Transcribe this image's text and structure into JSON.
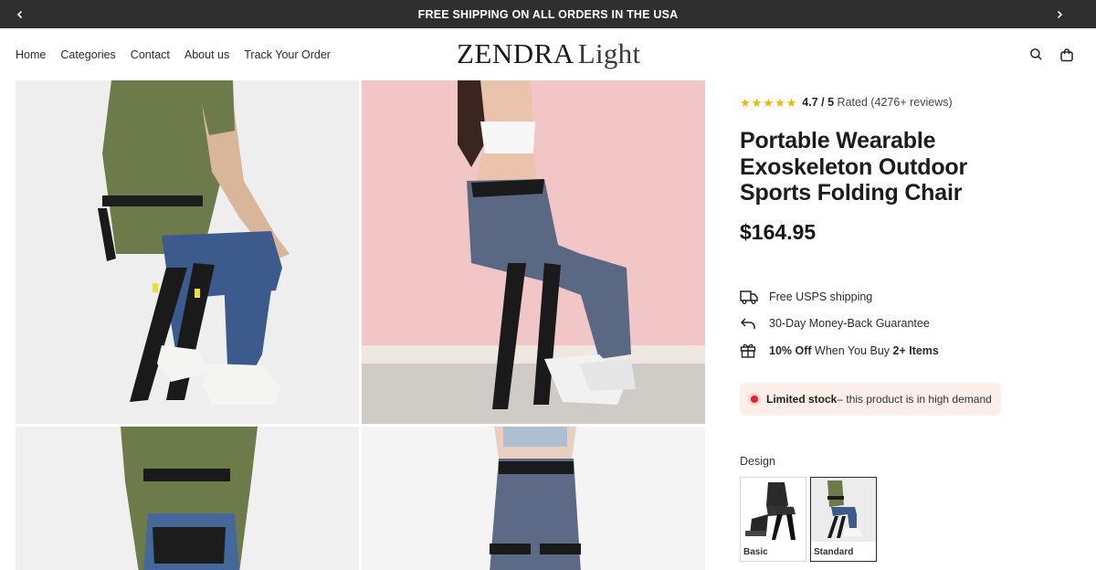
{
  "announcement": {
    "text": "FREE SHIPPING ON ALL ORDERS IN THE USA"
  },
  "nav": {
    "items": [
      "Home",
      "Categories",
      "Contact",
      "About us",
      "Track Your Order"
    ]
  },
  "logo": {
    "strong": "ZENDRA",
    "light": "Light"
  },
  "header_icons": [
    "search-icon",
    "bag-icon"
  ],
  "gallery": {
    "images": [
      "side-view-man-seated",
      "back-view-woman-seated-pink-wall",
      "back-view-man-standing",
      "back-view-woman-legs"
    ]
  },
  "product": {
    "rating_value": "4.7",
    "rating_scale": "/ 5",
    "rating_text": "Rated (4276+ reviews)",
    "stars": 5,
    "title": "Portable Wearable Exoskeleton Outdoor Sports Folding Chair",
    "price": "$164.95",
    "perks": [
      {
        "icon": "truck-icon",
        "text": "Free USPS shipping"
      },
      {
        "icon": "return-arrow-icon",
        "text": "30-Day Money-Back Guarantee"
      },
      {
        "icon": "gift-icon",
        "bold": "10% Off",
        "text": " When You Buy ",
        "bold2": "2+ Items"
      }
    ],
    "stock": {
      "bold": "Limited stock",
      "text": " – this product is in high demand"
    },
    "design": {
      "label": "Design",
      "options": [
        {
          "label": "Basic",
          "selected": false
        },
        {
          "label": "Standard",
          "selected": true
        }
      ]
    }
  },
  "colors": {
    "announce_bg": "#2f2f2f",
    "star": "#f5b301",
    "stock_bg": "#fcefe9",
    "stock_dot": "#e3212f"
  }
}
